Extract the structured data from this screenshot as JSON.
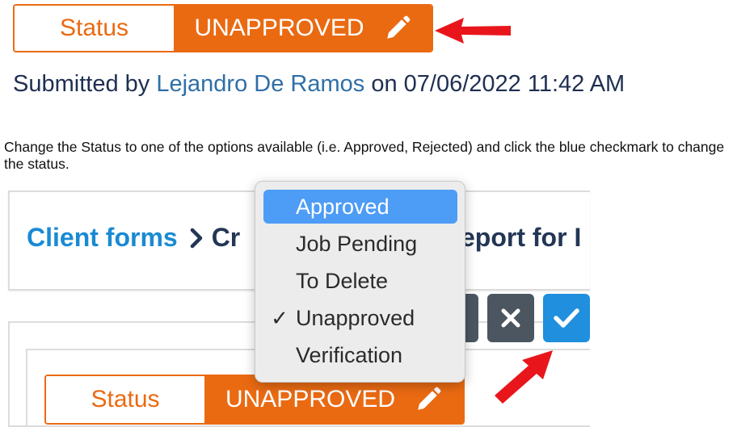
{
  "status_top": {
    "label": "Status",
    "value": "UNAPPROVED"
  },
  "submitted": {
    "prefix": "Submitted by",
    "submitter": "Lejandro De Ramos",
    "middle": "on",
    "datetime": "07/06/2022 11:42 AM"
  },
  "instructions": "Change the Status to one of the options available (i.e. Approved, Rejected) and click the blue checkmark to change the status.",
  "breadcrumb": {
    "link": "Client forms",
    "current": "Cr",
    "tail": "eport for I"
  },
  "dropdown": {
    "options": [
      {
        "label": "Approved",
        "checked": false,
        "highlighted": true
      },
      {
        "label": "Job Pending",
        "checked": false,
        "highlighted": false
      },
      {
        "label": "To Delete",
        "checked": false,
        "highlighted": false
      },
      {
        "label": "Unapproved",
        "checked": true,
        "highlighted": false
      },
      {
        "label": "Verification",
        "checked": false,
        "highlighted": false
      }
    ],
    "check_mark": "✓"
  },
  "status_bottom": {
    "label": "Status",
    "value": "UNAPPROVED"
  },
  "colors": {
    "orange": "#ea6a12",
    "red_arrow": "#e8161b",
    "blue_confirm": "#1f8fde",
    "gray_cancel": "#4b5661",
    "dropdown_highlight": "#4d9cf6"
  },
  "icons": {
    "pencil": "pencil-icon",
    "chevron": "chevron-right-icon",
    "cancel": "x-icon",
    "confirm": "checkmark-icon",
    "annotation_arrow": "arrow-icon"
  }
}
